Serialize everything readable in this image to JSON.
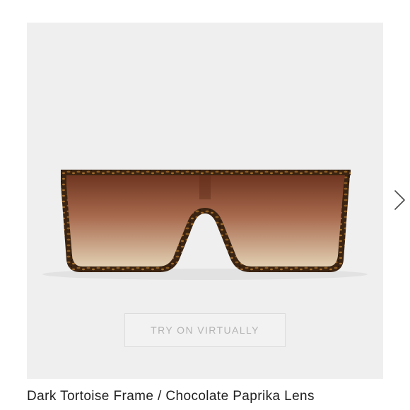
{
  "product": {
    "caption": "Dark Tortoise Frame / Chocolate Paprika Lens",
    "frame_color": "#3a2410",
    "lens_top_color": "#7a3e26",
    "lens_bottom_color": "#d9c2a2"
  },
  "gallery": {
    "try_on_label": "TRY ON VIRTUALLY",
    "next_icon": "chevron-right-icon"
  }
}
